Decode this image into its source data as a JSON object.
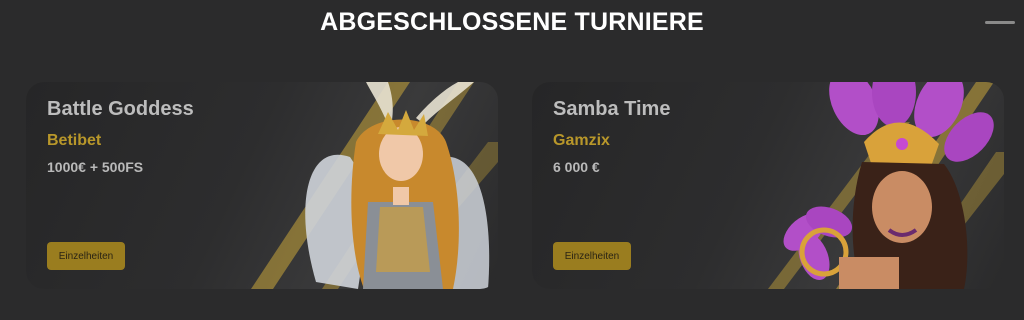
{
  "section": {
    "title": "ABGESCHLOSSENE TURNIERE"
  },
  "tournaments": [
    {
      "title": "Battle Goddess",
      "provider": "Betibet",
      "prize": "1000€ + 500FS",
      "button_label": "Einzelheiten",
      "art_icon": "winged-goddess-icon"
    },
    {
      "title": "Samba Time",
      "provider": "Gamzix",
      "prize": "6 000 €",
      "button_label": "Einzelheiten",
      "art_icon": "samba-dancer-icon"
    }
  ],
  "colors": {
    "accent": "#9a7d1f",
    "provider": "#b8972a",
    "background": "#2b2b2c"
  }
}
